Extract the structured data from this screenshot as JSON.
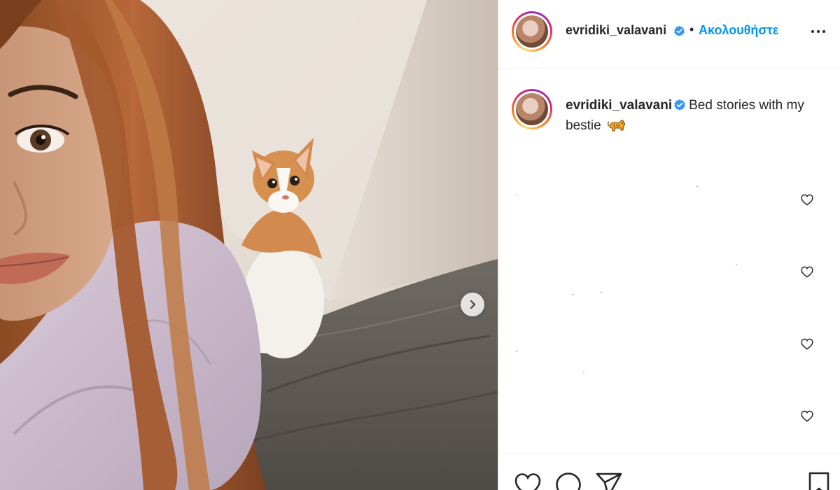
{
  "post": {
    "author": {
      "username": "evridiki_valavani",
      "verified": true,
      "follow_label": "Ακολουθήστε",
      "separator": "•"
    },
    "caption": {
      "username": "evridiki_valavani",
      "text": "Bed stories with my bestie",
      "emoji": "cat-emoji"
    },
    "comments": [
      {
        "liked": false
      },
      {
        "liked": false
      },
      {
        "liked": false
      },
      {
        "liked": false
      }
    ],
    "media": {
      "description_icon": "photo",
      "carousel_next": "chevron-right-icon"
    }
  },
  "icons": {
    "more": "more-options-icon",
    "like": "heart-icon",
    "comment": "comment-icon",
    "share": "send-icon",
    "save": "bookmark-icon",
    "verified": "verified-badge-icon"
  },
  "colors": {
    "accent": "#0095f6",
    "verified": "#3897f0",
    "text": "#262626",
    "border": "#dbdbdb"
  }
}
